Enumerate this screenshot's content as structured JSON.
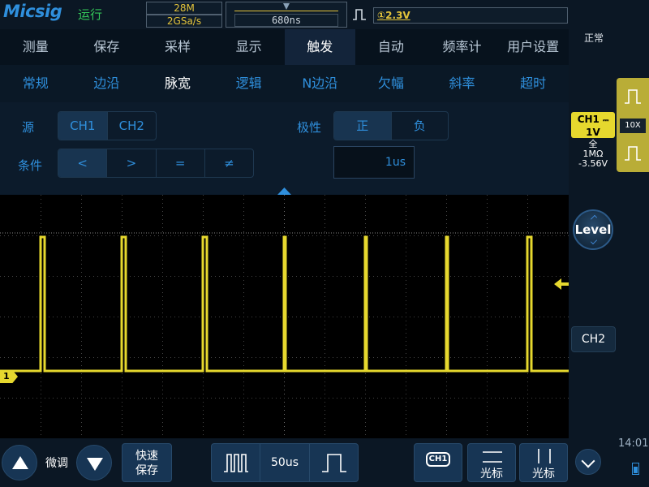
{
  "top_bar": {
    "brand": "Micsig",
    "run_state": "运行",
    "memory_depth": "28M",
    "sample_rate": "2GSa/s",
    "trigger_delay": "680ns",
    "trigger_level_channel_glyph": "①",
    "trigger_level": "2.3V",
    "trigger_status": "正常"
  },
  "main_menu": {
    "tabs": [
      "测量",
      "保存",
      "采样",
      "显示",
      "触发",
      "自动",
      "频率计",
      "用户设置"
    ],
    "active_index": 4
  },
  "trigger_type_menu": {
    "tabs": [
      "常规",
      "边沿",
      "脉宽",
      "逻辑",
      "N边沿",
      "欠幅",
      "斜率",
      "超时"
    ],
    "active_index": 2
  },
  "pulse_trigger_settings": {
    "source_label": "源",
    "sources": [
      "CH1",
      "CH2"
    ],
    "selected_source": "CH1",
    "polarity_label": "极性",
    "polarities": [
      "正",
      "负"
    ],
    "selected_polarity": "正",
    "condition_label": "条件",
    "conditions": [
      "<",
      ">",
      "=",
      "≠"
    ],
    "selected_condition": "<",
    "pulse_width": "1us"
  },
  "channel1": {
    "label": "CH1",
    "scale": "1V",
    "bandwidth": "全",
    "impedance": "1MΩ",
    "offset": "-3.56V",
    "probe_ratio": "10X",
    "marker": "1",
    "color": "#e6d82e"
  },
  "right_panel": {
    "level_knob_label": "Level",
    "ch2_button_label": "CH2"
  },
  "bottom_bar": {
    "fine_adjust_label": "微调",
    "quick_save_line1": "快速",
    "quick_save_line2": "保存",
    "timebase": "50us",
    "ch1_chip": "CH1",
    "cursor_horizontal_label": "光标",
    "cursor_vertical_label": "光标",
    "clock": "14:01"
  },
  "colors": {
    "accent": "#2f8fdc",
    "trace": "#e6d82e",
    "run": "#34c759"
  },
  "icons": {
    "trigger_type": "pulse-width-icon",
    "fine_up": "triangle-up-icon",
    "fine_down": "triangle-down-icon",
    "more": "chevron-down-icon",
    "battery": "battery-icon"
  }
}
